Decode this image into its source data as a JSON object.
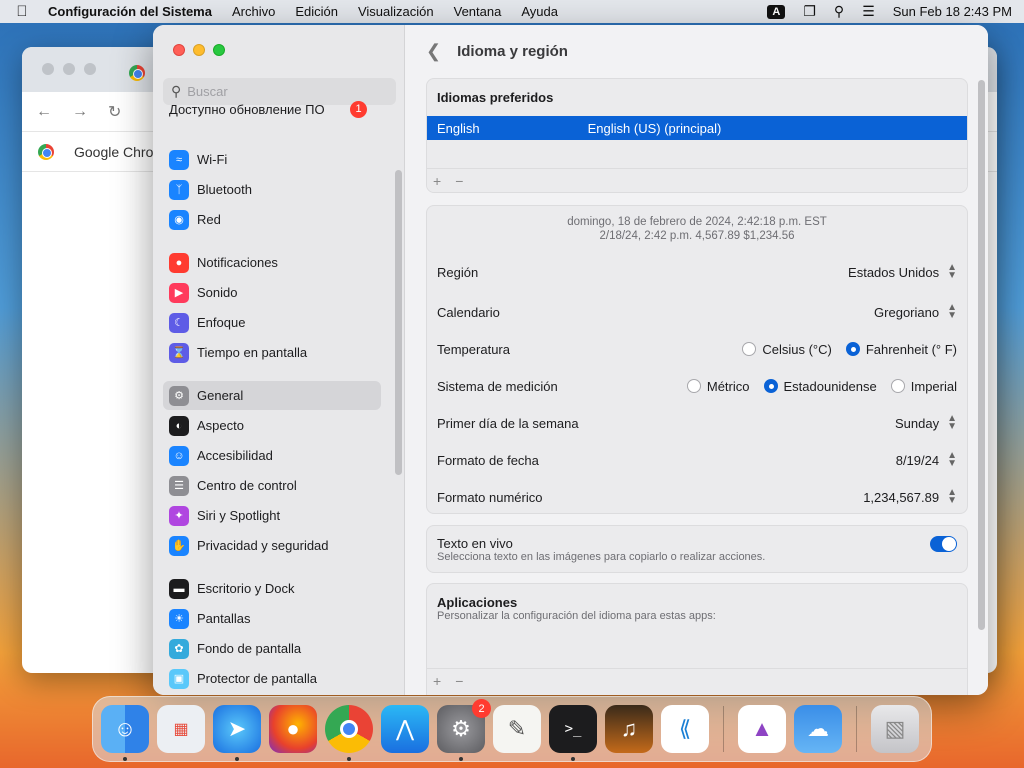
{
  "menubar": {
    "app_name": "Configuración del Sistema",
    "items": [
      "Archivo",
      "Edición",
      "Visualización",
      "Ventana",
      "Ayuda"
    ],
    "input_indicator": "A",
    "datetime": "Sun Feb 18  2:43 PM"
  },
  "background_window": {
    "bookmark_label": "Google Chrom"
  },
  "sidebar": {
    "search_placeholder": "Buscar",
    "update_item": "Доступно обновление ПО",
    "update_badge": "1",
    "items": [
      {
        "label": "Wi-Fi",
        "icon": "wifi-icon",
        "color": "#1a84ff"
      },
      {
        "label": "Bluetooth",
        "icon": "bluetooth-icon",
        "color": "#1a84ff"
      },
      {
        "label": "Red",
        "icon": "globe-icon",
        "color": "#1a84ff"
      },
      {
        "label": "Notificaciones",
        "icon": "bell-icon",
        "color": "#ff3b30"
      },
      {
        "label": "Sonido",
        "icon": "speaker-icon",
        "color": "#ff3b5c"
      },
      {
        "label": "Enfoque",
        "icon": "moon-icon",
        "color": "#5e5ce6"
      },
      {
        "label": "Tiempo en pantalla",
        "icon": "hourglass-icon",
        "color": "#5e5ce6"
      },
      {
        "label": "General",
        "icon": "gear-icon",
        "color": "#8e8e93"
      },
      {
        "label": "Aspecto",
        "icon": "appearance-icon",
        "color": "#1c1c1e"
      },
      {
        "label": "Accesibilidad",
        "icon": "accessibility-icon",
        "color": "#1a84ff"
      },
      {
        "label": "Centro de control",
        "icon": "switches-icon",
        "color": "#8e8e93"
      },
      {
        "label": "Siri y Spotlight",
        "icon": "siri-icon",
        "color": "#b046e0"
      },
      {
        "label": "Privacidad y seguridad",
        "icon": "hand-icon",
        "color": "#1a84ff"
      },
      {
        "label": "Escritorio y Dock",
        "icon": "dock-icon",
        "color": "#1c1c1e"
      },
      {
        "label": "Pantallas",
        "icon": "sun-icon",
        "color": "#1a84ff"
      },
      {
        "label": "Fondo de pantalla",
        "icon": "flower-icon",
        "color": "#34aadc"
      },
      {
        "label": "Protector de pantalla",
        "icon": "screensaver-icon",
        "color": "#5ac8fa"
      }
    ]
  },
  "content": {
    "title": "Idioma y región",
    "preferred_languages": {
      "title": "Idiomas preferidos",
      "language": "English",
      "language_detail": "English (US) (principal)",
      "add": "+",
      "remove": "−"
    },
    "preview": {
      "line1": "domingo, 18 de febrero de 2024, 2:42:18 p.m. EST",
      "line2": "2/18/24, 2:42 p.m.      4,567.89      $1,234.56"
    },
    "region": {
      "label": "Región",
      "value": "Estados Unidos"
    },
    "calendar": {
      "label": "Calendario",
      "value": "Gregoriano"
    },
    "temperature": {
      "label": "Temperatura",
      "option1": "Celsius (°C)",
      "option2": "Fahrenheit (° F)",
      "selected": "option2"
    },
    "measurement": {
      "label": "Sistema de medición",
      "option1": "Métrico",
      "option2": "Estadounidense",
      "option3": "Imperial",
      "selected": "option2"
    },
    "first_day": {
      "label": "Primer día de la semana",
      "value": "Sunday"
    },
    "date_format": {
      "label": "Formato de fecha",
      "value": "8/19/24"
    },
    "number_format": {
      "label": "Formato numérico",
      "value": "1,234,567.89"
    },
    "live_text": {
      "label": "Texto en vivo",
      "description": "Selecciona texto en las imágenes para copiarlo o realizar acciones.",
      "enabled": true
    },
    "apps": {
      "title": "Aplicaciones",
      "description": "Personalizar la configuración del idioma para estas apps:",
      "add": "+",
      "remove": "−"
    }
  },
  "dock": {
    "settings_badge": "2",
    "apps": [
      "finder-icon",
      "launchpad-icon",
      "safari-icon",
      "firefox-icon",
      "chrome-icon",
      "appstore-icon",
      "settings-icon",
      "textedit-icon",
      "terminal-icon",
      "garageband-icon",
      "vscode-icon",
      "visualstudio-icon",
      "weather-icon",
      "trash-icon"
    ]
  }
}
